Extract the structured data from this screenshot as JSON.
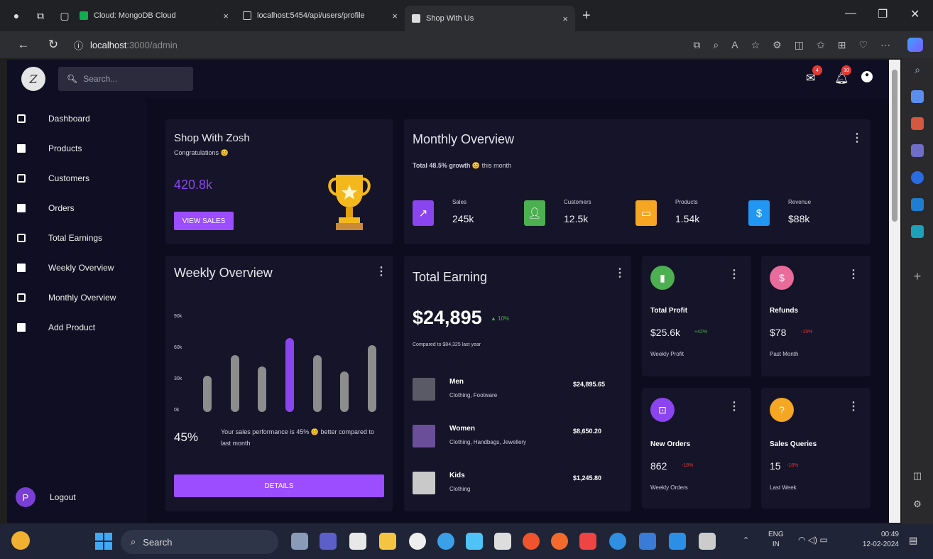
{
  "browser": {
    "tabs": [
      {
        "label": "Cloud: MongoDB Cloud"
      },
      {
        "label": "localhost:5454/api/users/profile"
      },
      {
        "label": "Shop With Us"
      }
    ],
    "url_host": "localhost",
    "url_path": ":3000/admin"
  },
  "app": {
    "logo_text": "Z",
    "search_placeholder": "Search...",
    "mail_badge": "4",
    "notif_badge": "10"
  },
  "sidebar": {
    "items": [
      {
        "label": "Dashboard",
        "icon": "inbox-icon"
      },
      {
        "label": "Products",
        "icon": "mail-icon"
      },
      {
        "label": "Customers",
        "icon": "inbox-icon"
      },
      {
        "label": "Orders",
        "icon": "mail-icon"
      },
      {
        "label": "Total Earnings",
        "icon": "inbox-icon"
      },
      {
        "label": "Weekly Overview",
        "icon": "mail-icon"
      },
      {
        "label": "Monthly Overview",
        "icon": "inbox-icon"
      },
      {
        "label": "Add Product",
        "icon": "mail-icon"
      }
    ],
    "logout_avatar": "P",
    "logout_label": "Logout"
  },
  "shop_card": {
    "title": "Shop With Zosh",
    "subtitle": "Congratulations",
    "value": "420.8k",
    "button": "VIEW SALES"
  },
  "monthly": {
    "title": "Monthly Overview",
    "growth_bold": "Total 48.5% growth",
    "growth_rest": "this month",
    "stats": [
      {
        "label": "Sales",
        "value": "245k",
        "color": "#8b45f0"
      },
      {
        "label": "Customers",
        "value": "12.5k",
        "color": "#4caf50"
      },
      {
        "label": "Products",
        "value": "1.54k",
        "color": "#f5a623"
      },
      {
        "label": "Revenue",
        "value": "$88k",
        "color": "#2196f3"
      }
    ]
  },
  "weekly": {
    "title": "Weekly Overview",
    "y_ticks": [
      "90k",
      "60k",
      "30k",
      "0k"
    ],
    "percent": "45%",
    "text": "Your sales performance is 45% 😊 better compared to last month",
    "button": "DETAILS"
  },
  "chart_data": {
    "type": "bar",
    "ylim": [
      0,
      90
    ],
    "values": [
      34,
      54,
      43,
      70,
      54,
      38,
      63
    ],
    "highlight_index": 3
  },
  "earning": {
    "title": "Total Earning",
    "amount": "$24,895",
    "change": "10%",
    "compare": "Compared to $84,325 last year",
    "rows": [
      {
        "name": "Men",
        "sub": "Clothing, Footware",
        "amount": "$24,895.65"
      },
      {
        "name": "Women",
        "sub": "Clothing, Handbags, Jewellery",
        "amount": "$8,650.20"
      },
      {
        "name": "Kids",
        "sub": "Clothing",
        "amount": "$1,245.80"
      }
    ]
  },
  "minis": [
    {
      "title": "Total Profit",
      "value": "$25.6k",
      "pct": "+42%",
      "sub": "Weekly Profit",
      "color": "#4caf50",
      "pct_color": "#4caf50"
    },
    {
      "title": "Refunds",
      "value": "$78",
      "pct": "-15%",
      "sub": "Past Month",
      "color": "#e96b9a",
      "pct_color": "#e53935"
    },
    {
      "title": "New Orders",
      "value": "862",
      "pct": "-18%",
      "sub": "Weekly Orders",
      "color": "#8b45f0",
      "pct_color": "#e53935"
    },
    {
      "title": "Sales Queries",
      "value": "15",
      "pct": "-18%",
      "sub": "Last Week",
      "color": "#f5a623",
      "pct_color": "#e53935"
    }
  ],
  "taskbar": {
    "search": "Search",
    "lang1": "ENG",
    "lang2": "IN",
    "time": "00:49",
    "date": "12-02-2024"
  }
}
